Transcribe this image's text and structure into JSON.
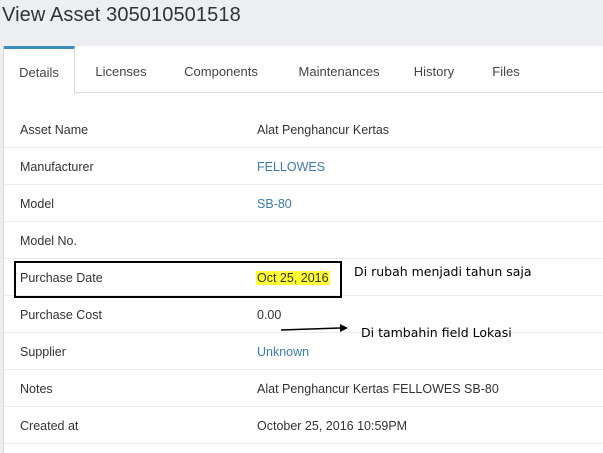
{
  "title": "View Asset 305010501518",
  "tabs": [
    {
      "label": "Details",
      "active": true
    },
    {
      "label": "Licenses"
    },
    {
      "label": "Components"
    },
    {
      "label": "Maintenances"
    },
    {
      "label": "History"
    },
    {
      "label": "Files"
    }
  ],
  "details": [
    {
      "label": "Asset Name",
      "value": "Alat Penghancur Kertas"
    },
    {
      "label": "Manufacturer",
      "value": "FELLOWES"
    },
    {
      "label": "Model",
      "value": "SB-80"
    },
    {
      "label": "Model No.",
      "value": ""
    },
    {
      "label": "Purchase Date",
      "value": "Oct 25, 2016"
    },
    {
      "label": "Purchase Cost",
      "value": "0.00"
    },
    {
      "label": "Supplier",
      "value": "Unknown"
    },
    {
      "label": "Notes",
      "value": "Alat Penghancur Kertas FELLOWES SB-80"
    },
    {
      "label": "Created at",
      "value": "October 25, 2016 10:59PM"
    }
  ],
  "annotations": {
    "note_1": "Di rubah menjadi tahun saja",
    "note_2": "Di tambahin field Lokasi"
  },
  "colors": {
    "link": "#3c7cac",
    "highlight": "#ffff33",
    "active_tab_border": "#3c8dbc"
  }
}
